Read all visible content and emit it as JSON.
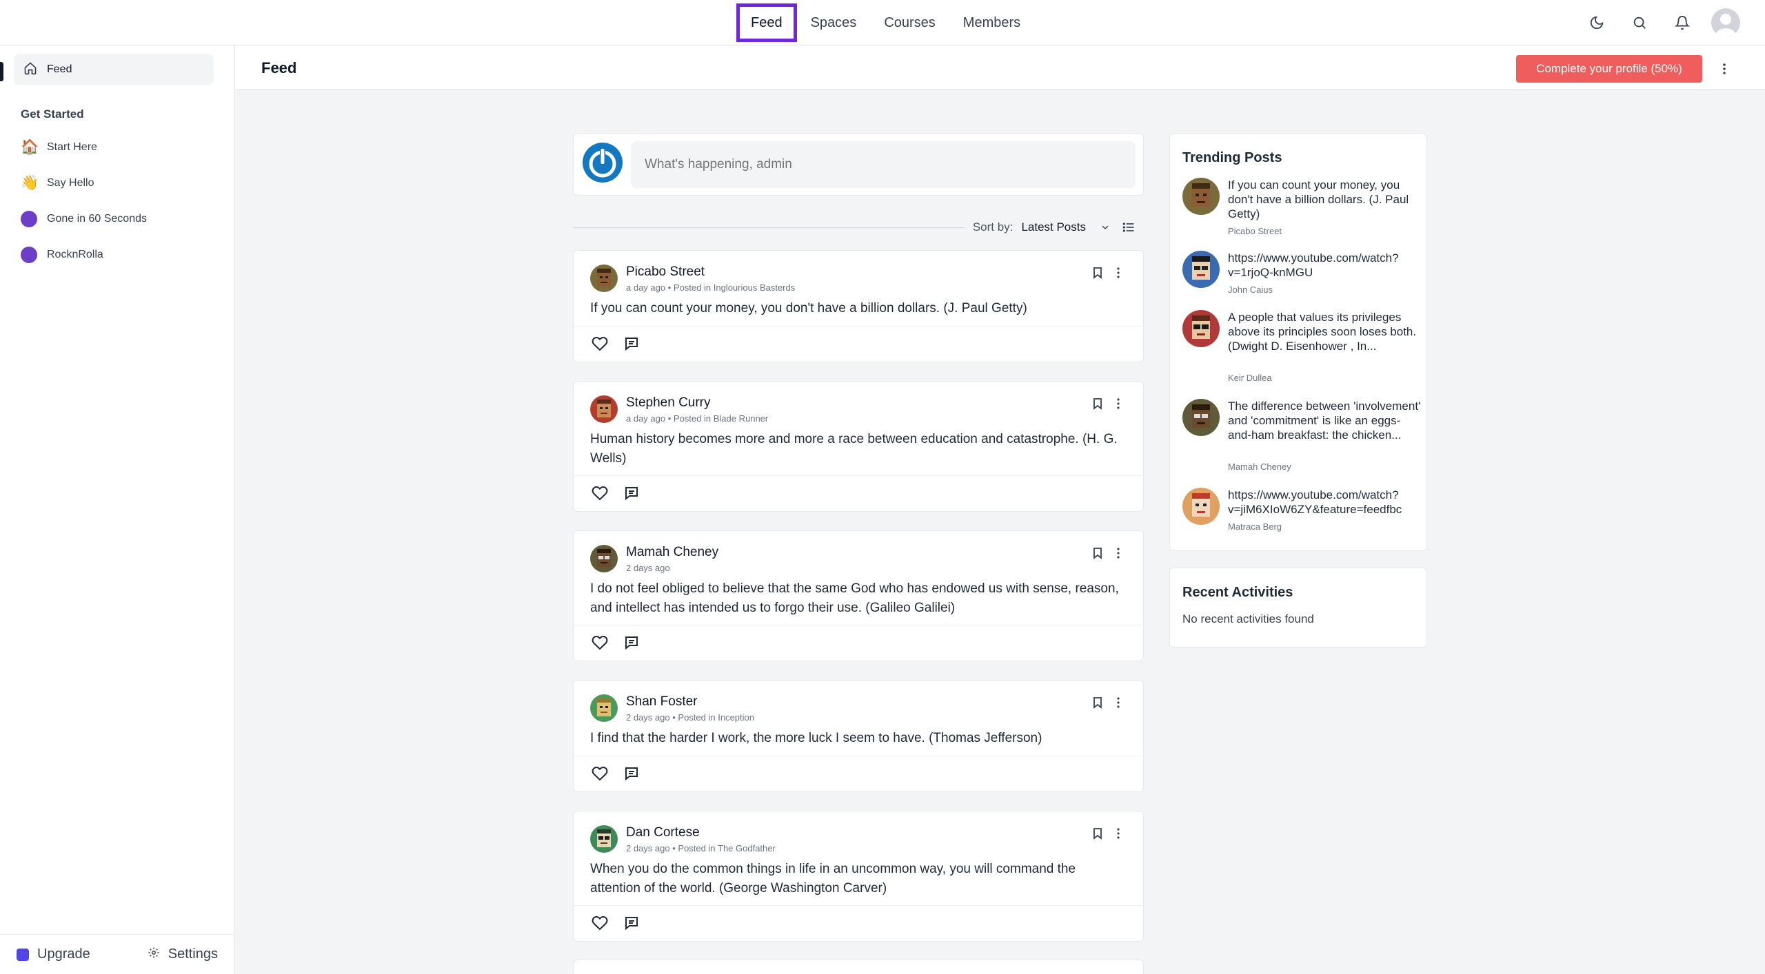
{
  "topnav": {
    "items": [
      {
        "label": "Feed",
        "active": true
      },
      {
        "label": "Spaces"
      },
      {
        "label": "Courses"
      },
      {
        "label": "Members"
      }
    ]
  },
  "sidebar": {
    "feed_label": "Feed",
    "section_heading": "Get Started",
    "items": [
      {
        "label": "Start Here",
        "emoji": "🏠"
      },
      {
        "label": "Say Hello",
        "emoji": "👋"
      },
      {
        "label": "Gone in 60 Seconds"
      },
      {
        "label": "RocknRolla"
      }
    ],
    "upgrade_label": "Upgrade",
    "settings_label": "Settings"
  },
  "header": {
    "title": "Feed",
    "profile_button": "Complete your profile (50%)"
  },
  "composer": {
    "placeholder": "What's happening, admin"
  },
  "sort": {
    "label": "Sort by:",
    "value": "Latest Posts"
  },
  "posts": [
    {
      "author": "Picabo Street",
      "time": "a day ago",
      "space": "Inglourious Basterds",
      "body": "If you can count your money, you don't have a billion dollars. (J. Paul Getty)"
    },
    {
      "author": "Stephen Curry",
      "time": "a day ago",
      "space": "Blade Runner",
      "body": "Human history becomes more and more a race between education and catastrophe. (H. G. Wells)"
    },
    {
      "author": "Mamah Cheney",
      "time": "2 days ago",
      "space": "",
      "body": "I do not feel obliged to believe that the same God who has endowed us with sense, reason, and intellect has intended us to forgo their use. (Galileo Galilei)"
    },
    {
      "author": "Shan Foster",
      "time": "2 days ago",
      "space": "Inception",
      "body": "I find that the harder I work, the more luck I seem to have. (Thomas Jefferson)"
    },
    {
      "author": "Dan Cortese",
      "time": "2 days ago",
      "space": "The Godfather",
      "body": "When you do the common things in life in an uncommon way, you will command the attention of the world. (George Washington Carver)"
    }
  ],
  "posted_in_prefix": "• Posted in",
  "trending": {
    "title": "Trending Posts",
    "items": [
      {
        "text": "If you can count your money, you don't have a billion dollars. (J. Paul Getty)",
        "author": "Picabo Street"
      },
      {
        "text": "https://www.youtube.com/watch?v=1rjoQ-knMGU",
        "author": "John Caius"
      },
      {
        "text": "A people that values its privileges above its principles soon loses both. (Dwight D. Eisenhower , In...",
        "author": "Keir Dullea"
      },
      {
        "text": "The difference between 'involvement' and 'commitment' is like an eggs-and-ham breakfast: the chicken...",
        "author": "Mamah Cheney"
      },
      {
        "text": "https://www.youtube.com/watch?v=jiM6XIoW6ZY&feature=feedfbc",
        "author": "Matraca Berg"
      }
    ]
  },
  "recent": {
    "title": "Recent Activities",
    "empty": "No recent activities found"
  },
  "colors": {
    "accent": "#6d28d9",
    "profile_button": "#ef5d5d",
    "space_dot": "#6d3fc9"
  }
}
